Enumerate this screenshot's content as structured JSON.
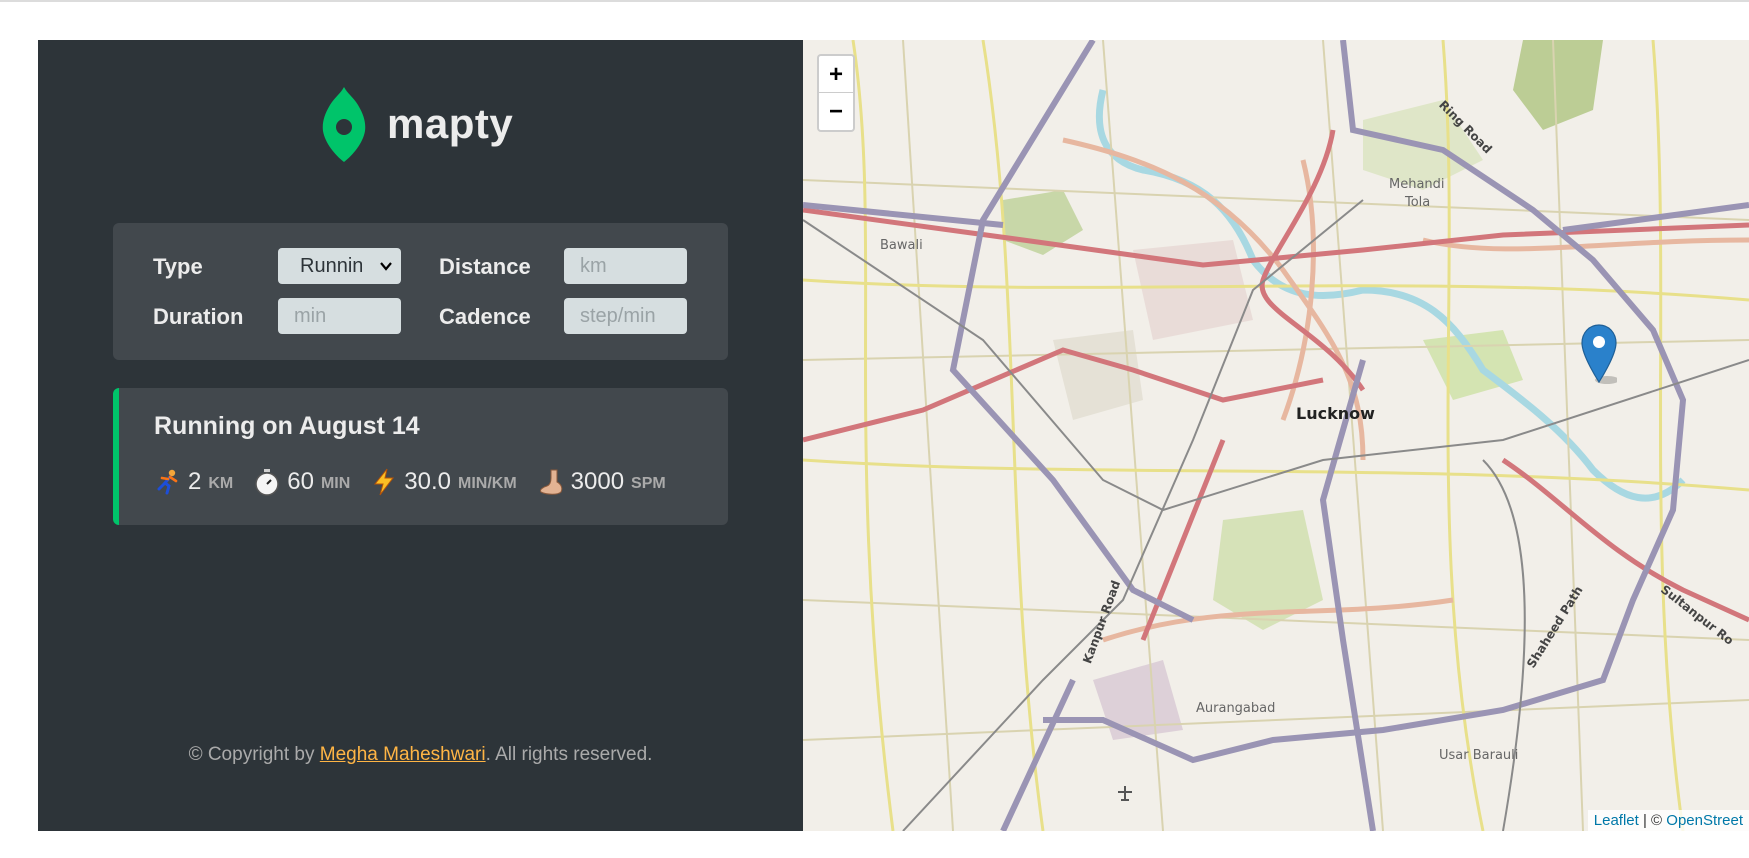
{
  "brand": {
    "name": "mapty",
    "accent": "#00c46a",
    "highlight": "#ffb545"
  },
  "form": {
    "type_label": "Type",
    "type_value": "Running",
    "distance_label": "Distance",
    "distance_placeholder": "km",
    "duration_label": "Duration",
    "duration_placeholder": "min",
    "cadence_label": "Cadence",
    "cadence_placeholder": "step/min"
  },
  "workouts": [
    {
      "title": "Running on August 14",
      "details": [
        {
          "icon": "runner-icon",
          "value": "2",
          "unit": "km"
        },
        {
          "icon": "stopwatch-icon",
          "value": "60",
          "unit": "min"
        },
        {
          "icon": "lightning-icon",
          "value": "30.0",
          "unit": "min/km"
        },
        {
          "icon": "foot-icon",
          "value": "3000",
          "unit": "spm"
        }
      ]
    }
  ],
  "footer": {
    "prefix": "© Copyright by ",
    "author": "Megha Maheshwari",
    "suffix": ". All rights reserved."
  },
  "map": {
    "zoom_in": "+",
    "zoom_out": "−",
    "labels": {
      "city": "Lucknow",
      "bawali": "Bawali",
      "mehandi": "Mehandi",
      "tola": "Tola",
      "ring_road": "Ring Road",
      "kanpur_road": "Kanpur Road",
      "shaheed_path": "Shaheed Path",
      "sultanpur_road": "Sultanpur Ro",
      "aurangabad": "Aurangabad",
      "usar_barauli": "Usar Barauli"
    },
    "attribution": {
      "leaflet": "Leaflet",
      "sep": " | © ",
      "osm": "OpenStreet"
    },
    "marker_color": "#2a81cb"
  }
}
